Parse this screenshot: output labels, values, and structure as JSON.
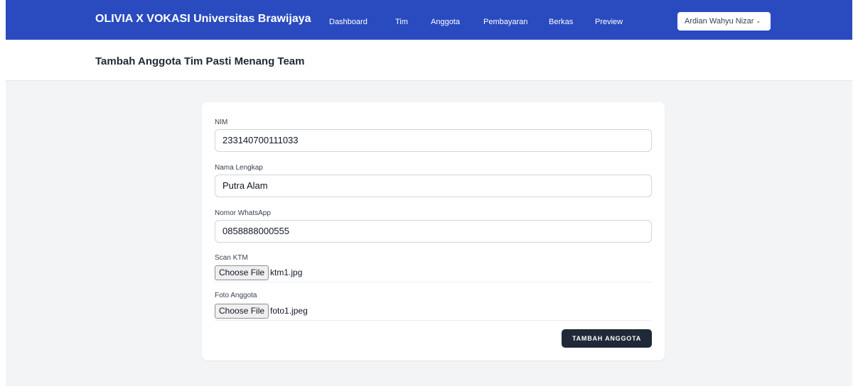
{
  "navbar": {
    "brand": "OLIVIA X VOKASI Universitas Brawijaya",
    "items": [
      {
        "label": "Dashboard"
      },
      {
        "label": "Tim"
      },
      {
        "label": "Anggota"
      },
      {
        "label": "Pembayaran"
      },
      {
        "label": "Berkas"
      },
      {
        "label": "Preview"
      }
    ],
    "user": {
      "name": "Ardian Wahyu Nizar",
      "chevron_icon": "chevron-down-icon"
    }
  },
  "header": {
    "title": "Tambah Anggota Tim Pasti Menang Team"
  },
  "form": {
    "nim": {
      "label": "NIM",
      "value": "233140700111033"
    },
    "nama": {
      "label": "Nama Lengkap",
      "value": "Putra Alam"
    },
    "whatsapp": {
      "label": "Nomor WhatsApp",
      "value": "0858888000555"
    },
    "ktm": {
      "label": "Scan KTM",
      "button": "Choose File",
      "file": "ktm1.jpg"
    },
    "foto": {
      "label": "Foto Anggota",
      "button": "Choose File",
      "file": "foto1.jpeg"
    },
    "submit": "TAMBAH ANGGOTA"
  },
  "colors": {
    "navbar": "#2a4bbf",
    "page_background": "#f3f4f6",
    "submit_button": "#1f2937"
  }
}
